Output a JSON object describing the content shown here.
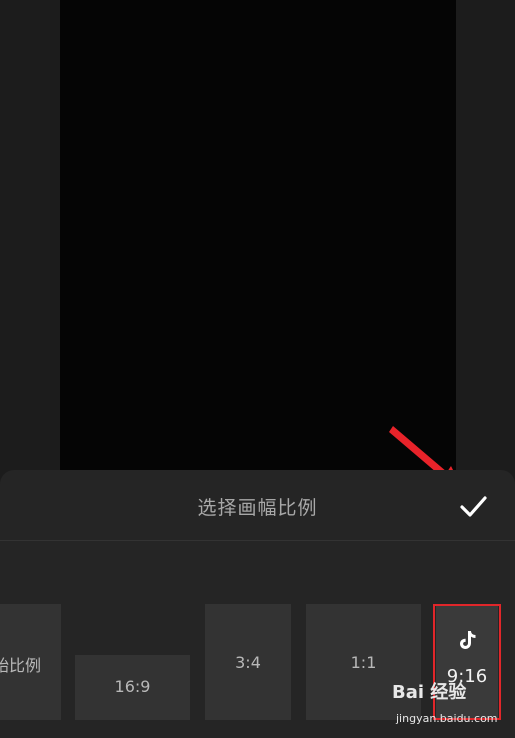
{
  "header": {
    "title": "选择画幅比例",
    "confirm_icon": "checkmark-icon"
  },
  "ratios": [
    {
      "label": "原始比例",
      "visible_label": "始比例",
      "selected": false
    },
    {
      "label": "16:9",
      "selected": false
    },
    {
      "label": "3:4",
      "selected": false
    },
    {
      "label": "1:1",
      "selected": false
    },
    {
      "label": "9:16",
      "selected": true,
      "icon": "tiktok-icon"
    }
  ],
  "watermark": {
    "text": "Bai 经验",
    "url": "jingyan.baidu.com"
  },
  "colors": {
    "background": "#1c1c1c",
    "panel": "#252525",
    "option": "#333333",
    "highlight": "#e0262a"
  }
}
